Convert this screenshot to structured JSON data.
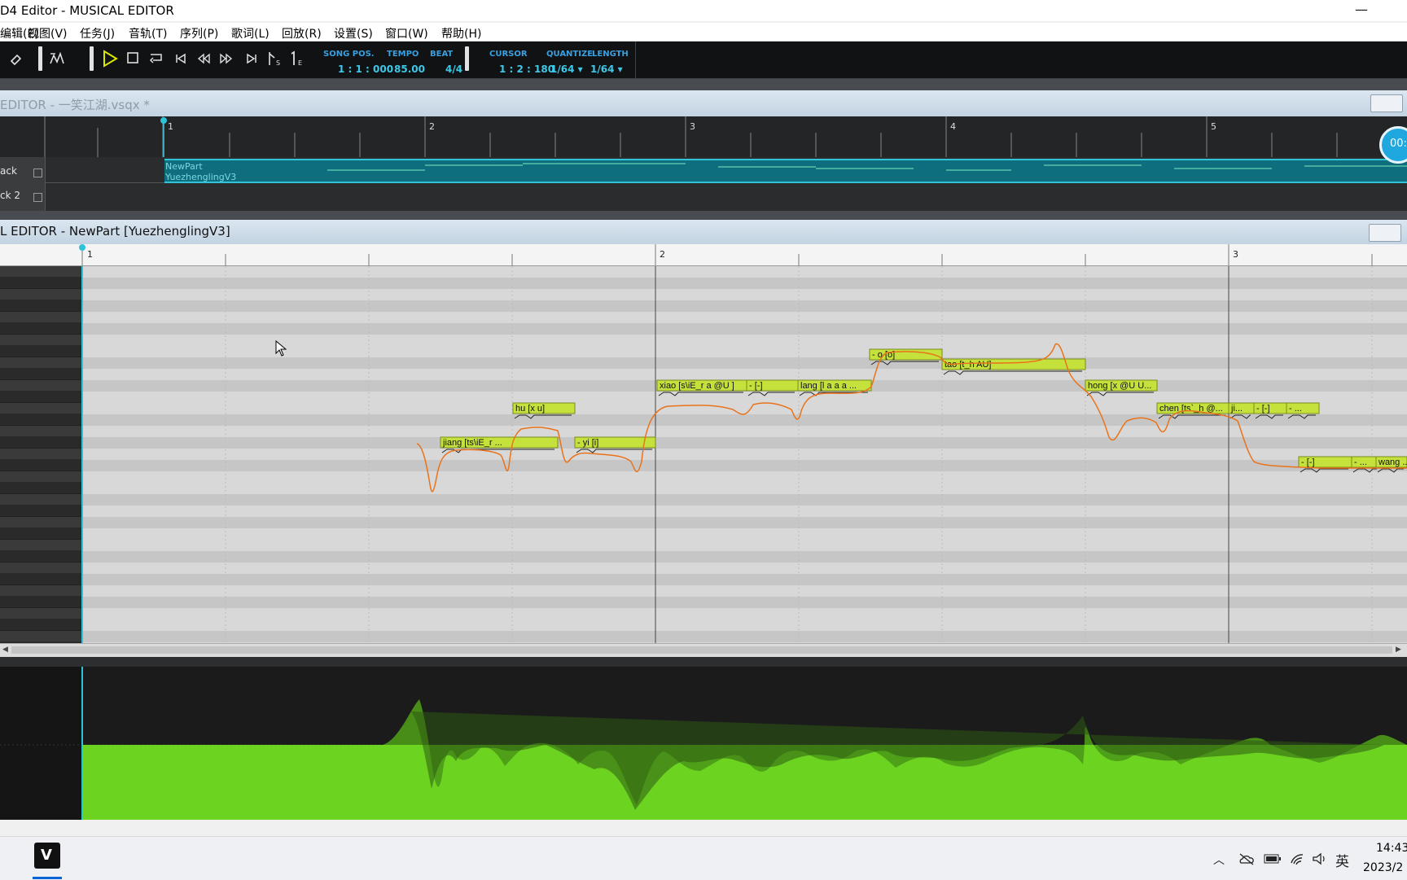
{
  "window": {
    "title": "D4 Editor - MUSICAL EDITOR",
    "minimize_glyph": "—"
  },
  "menu": [
    "编辑(E)",
    "视图(V)",
    "任务(J)",
    "音轨(T)",
    "序列(P)",
    "歌词(L)",
    "回放(R)",
    "设置(S)",
    "窗口(W)",
    "帮助(H)"
  ],
  "toolbar": {
    "icons": [
      "eraser-icon",
      "pencil-curve-icon",
      "play-icon",
      "stop-icon",
      "loop-icon",
      "go-start-icon",
      "rewind-icon",
      "fast-forward-icon",
      "go-end-icon",
      "start-marker-icon",
      "end-marker-icon"
    ],
    "song_pos": {
      "label": "SONG POS.",
      "value": "1 : 1 : 000"
    },
    "tempo": {
      "label": "TEMPO",
      "value": "85.00"
    },
    "beat": {
      "label": "BEAT",
      "value": "4/4"
    },
    "cursor": {
      "label": "CURSOR",
      "value": "1 : 2 : 180"
    },
    "quantize": {
      "label": "QUANTIZE",
      "value": "1/64 ▾"
    },
    "length": {
      "label": "LENGTH",
      "value": "1/64 ▾"
    }
  },
  "track_editor": {
    "title": "EDITOR - 一笑江湖.vsqx *",
    "measures": [
      "1",
      "2",
      "3",
      "4",
      "5"
    ],
    "tracks": [
      {
        "name": "ack"
      },
      {
        "name": "ck 2"
      }
    ],
    "part": {
      "name": "NewPart",
      "singer": "YuezhenglingV3"
    },
    "time_badge": "00:"
  },
  "musical_editor": {
    "title": "L EDITOR - NewPart [YuezhenglingV3]",
    "measures": [
      "1",
      "2",
      "3"
    ],
    "notes": [
      {
        "lyric": "jiang [ts\\iE_r ..."
      },
      {
        "lyric": "hu [x u]"
      },
      {
        "lyric": "- yi [i]"
      },
      {
        "lyric": "xiao [s\\iE_r a @U ]"
      },
      {
        "lyric": "- [-]"
      },
      {
        "lyric": "lang [l a a a ..."
      },
      {
        "lyric": "- o [o]"
      },
      {
        "lyric": "tao [t_h AU]"
      },
      {
        "lyric": "hong [x @U U..."
      },
      {
        "lyric": "chen [ts`_h @..."
      },
      {
        "lyric": "ji..."
      },
      {
        "lyric": "- [-]"
      },
      {
        "lyric": "- ..."
      },
      {
        "lyric": "- [-]"
      },
      {
        "lyric": "- ..."
      },
      {
        "lyric": "wang ..."
      }
    ]
  },
  "taskbar": {
    "app_icon": "V",
    "ime": "英",
    "time": "14:43",
    "date": "2023/2",
    "tray_icons": [
      "chevron-up-icon",
      "onedrive-icon",
      "battery-icon",
      "wifi-icon",
      "volume-icon"
    ]
  },
  "colors": {
    "note_fill": "#c5e23c",
    "pitch_curve": "#e9731c",
    "dynamics_fill": "#6cd420",
    "accent_cyan": "#3ec8e8",
    "part_teal": "#0e6e7e"
  }
}
